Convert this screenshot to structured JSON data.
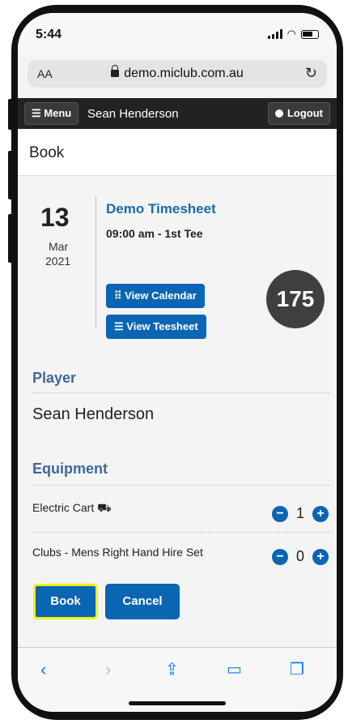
{
  "status_bar": {
    "time": "5:44"
  },
  "browser": {
    "text_size": "AA",
    "url": "demo.miclub.com.au"
  },
  "nav": {
    "menu_label": "☰ Menu",
    "user_name": "Sean Henderson",
    "logout_label": "Logout"
  },
  "page": {
    "title": "Book"
  },
  "booking": {
    "day": "13",
    "month": "Mar",
    "year": "2021",
    "timesheet": "Demo Timesheet",
    "tee_time": "09:00 am - 1st Tee",
    "view_calendar": "⠿ View Calendar",
    "view_teesheet": "☰ View Teesheet",
    "number": "175"
  },
  "player": {
    "section_title": "Player",
    "name": "Sean Henderson"
  },
  "equipment": {
    "section_title": "Equipment",
    "items": [
      {
        "label": "Electric Cart",
        "qty": "1"
      },
      {
        "label": "Clubs - Mens Right Hand Hire Set",
        "qty": "0"
      }
    ]
  },
  "actions": {
    "book": "Book",
    "cancel": "Cancel"
  },
  "colors": {
    "accent": "#0a65b3",
    "focus": "#f0f400",
    "heading": "#3e6a96"
  }
}
